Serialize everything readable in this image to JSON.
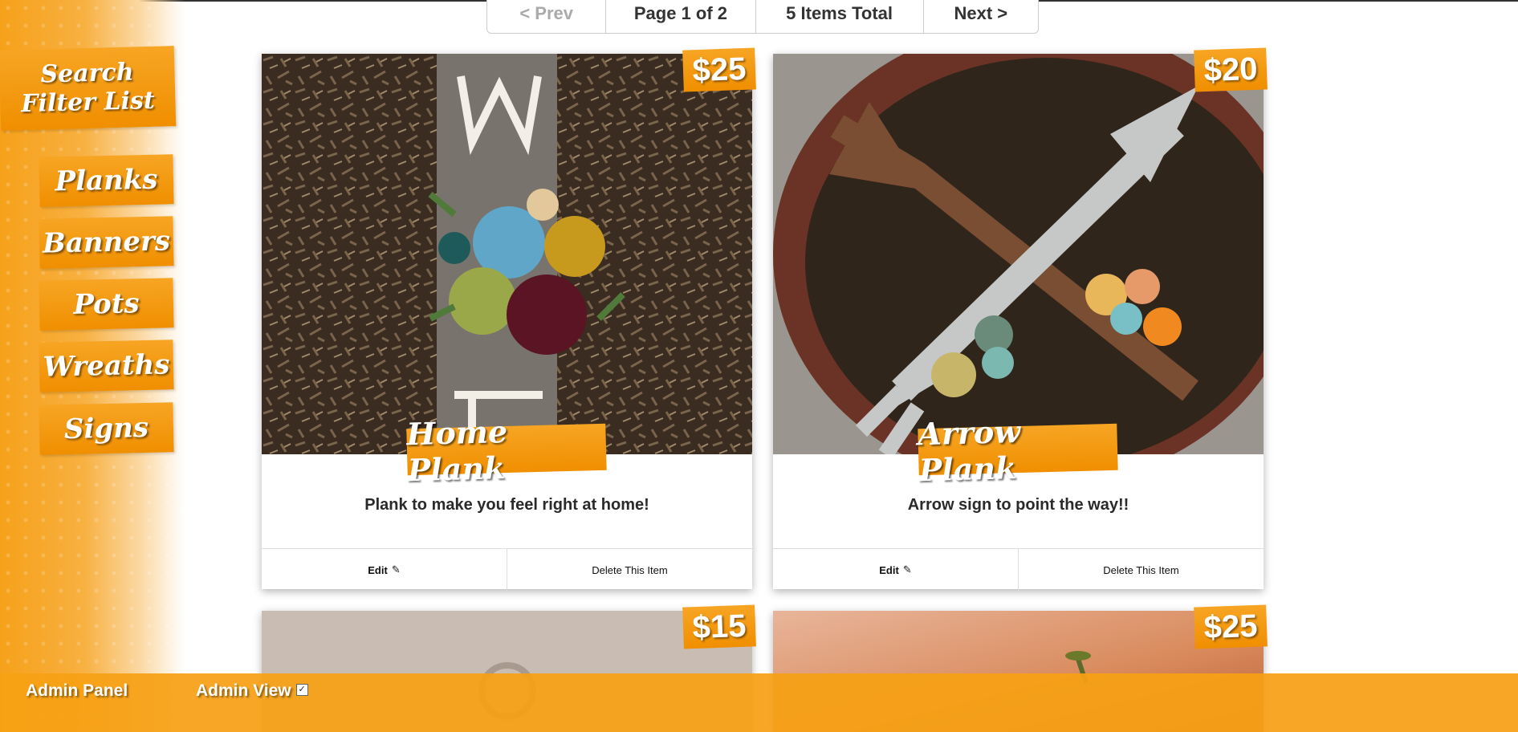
{
  "pagination": {
    "prev_label": "< Prev",
    "page_label": "Page 1 of 2",
    "total_label": "5 Items Total",
    "next_label": "Next >"
  },
  "sidebar": {
    "title": "Search Filter List",
    "categories": [
      {
        "label": "Planks"
      },
      {
        "label": "Banners"
      },
      {
        "label": "Pots"
      },
      {
        "label": "Wreaths"
      },
      {
        "label": "Signs"
      }
    ]
  },
  "cards": [
    {
      "name": "Home Plank",
      "price": "$25",
      "description": "Plank to make you feel right at home!",
      "edit_label": "Edit",
      "delete_label": "Delete This Item"
    },
    {
      "name": "Arrow Plank",
      "price": "$20",
      "description": "Arrow sign to point the way!!",
      "edit_label": "Edit",
      "delete_label": "Delete This Item"
    },
    {
      "price": "$15"
    },
    {
      "price": "$25"
    }
  ],
  "footer": {
    "admin_panel_label": "Admin Panel",
    "admin_view_label": "Admin View",
    "admin_view_checked": true
  },
  "colors": {
    "accent": "#f39a10",
    "footer": "#f6a014"
  }
}
